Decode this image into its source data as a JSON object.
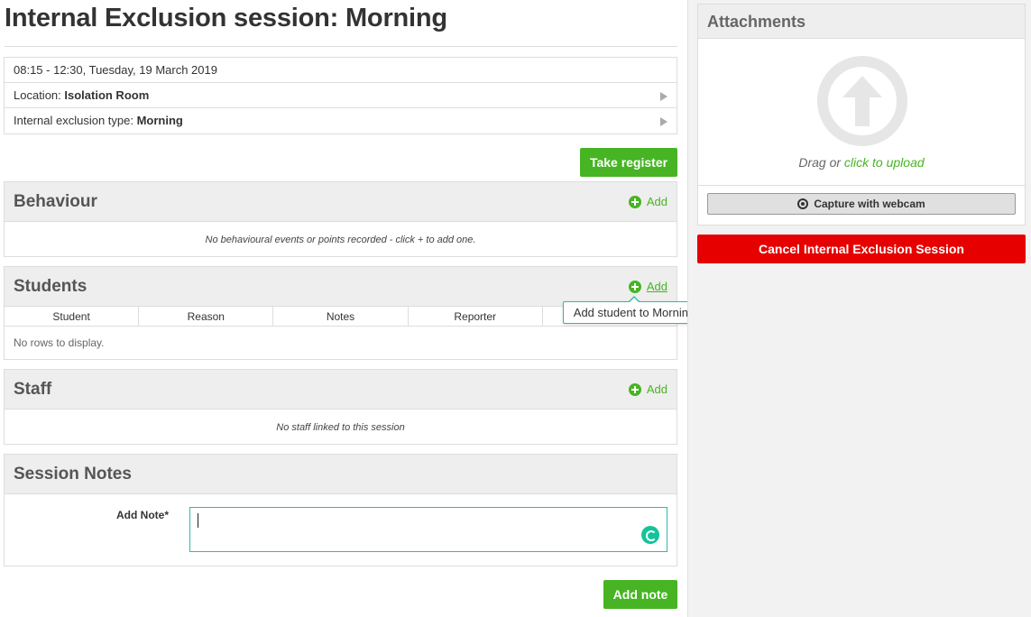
{
  "page": {
    "title_prefix": "Internal Exclusion session: ",
    "title_strong": "Morning"
  },
  "info": {
    "datetime": "08:15 - 12:30, Tuesday, 19 March 2019",
    "location_label": "Location: ",
    "location_value": "Isolation Room",
    "type_label": "Internal exclusion type: ",
    "type_value": "Morning"
  },
  "actions": {
    "take_register": "Take register",
    "add_note": "Add note",
    "cancel": "Cancel Internal Exclusion Session"
  },
  "behaviour": {
    "title": "Behaviour",
    "add": "Add",
    "empty": "No behavioural events or points recorded - click + to add one."
  },
  "students": {
    "title": "Students",
    "add": "Add",
    "columns": [
      "Student",
      "Reason",
      "Notes",
      "Reporter",
      ""
    ],
    "empty": "No rows to display.",
    "tooltip": "Add student to Morning"
  },
  "staff": {
    "title": "Staff",
    "add": "Add",
    "empty": "No staff linked to this session"
  },
  "notes": {
    "title": "Session Notes",
    "label": "Add Note*",
    "value": ""
  },
  "attachments": {
    "title": "Attachments",
    "drag_text": "Drag or ",
    "click_text": "click to upload",
    "webcam": "Capture with webcam"
  },
  "colors": {
    "green": "#47b424",
    "red": "#e60000",
    "teal": "#2bbbad"
  }
}
